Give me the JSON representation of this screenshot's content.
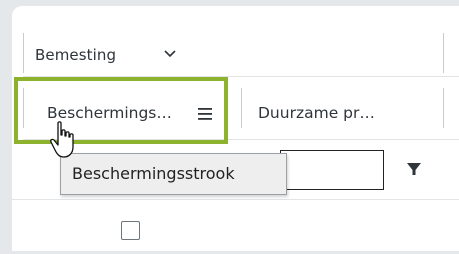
{
  "header": {
    "group_label": "Bemesting",
    "group_icon": "chevron-down-icon"
  },
  "columns": [
    {
      "label": "Beschermings…",
      "menu_icon": "hamburger-menu-icon"
    },
    {
      "label": "Duurzame pr…"
    }
  ],
  "filter": {
    "value": "",
    "icon": "filter-funnel-icon"
  },
  "tooltip": {
    "text": "Beschermingsstrook"
  },
  "row": {
    "checkbox_checked": false
  },
  "colors": {
    "highlight": "#8db22e",
    "text": "#2f353b",
    "border": "#c8ccd0"
  }
}
